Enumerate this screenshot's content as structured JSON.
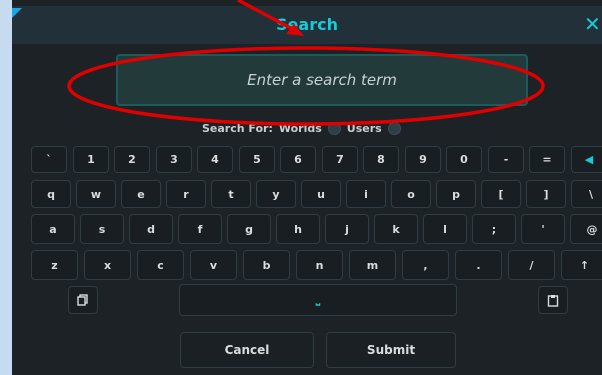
{
  "header": {
    "title": "Search",
    "close_glyph": "✕"
  },
  "search": {
    "placeholder": "Enter a search term",
    "value": ""
  },
  "search_for": {
    "label": "Search For:",
    "options": [
      {
        "label": "Worlds"
      },
      {
        "label": "Users"
      }
    ]
  },
  "keyboard": {
    "rows": [
      [
        "`",
        "1",
        "2",
        "3",
        "4",
        "5",
        "6",
        "7",
        "8",
        "9",
        "0",
        "-",
        "=",
        "◀"
      ],
      [
        "q",
        "w",
        "e",
        "r",
        "t",
        "y",
        "u",
        "i",
        "o",
        "p",
        "[",
        "]",
        "\\"
      ],
      [
        "a",
        "s",
        "d",
        "f",
        "g",
        "h",
        "j",
        "k",
        "l",
        ";",
        "'",
        "@"
      ],
      [
        "z",
        "x",
        "c",
        "v",
        "b",
        "n",
        "m",
        ",",
        ".",
        "/",
        "↑"
      ]
    ],
    "space_glyph": "⎵"
  },
  "actions": {
    "cancel_label": "Cancel",
    "submit_label": "Submit"
  },
  "annotation": {
    "color": "#e00000",
    "shape": "ellipse around search field with arrow"
  },
  "colors": {
    "accent": "#18c9d6",
    "background": "#1d2226",
    "page": "#c6dbf0"
  }
}
